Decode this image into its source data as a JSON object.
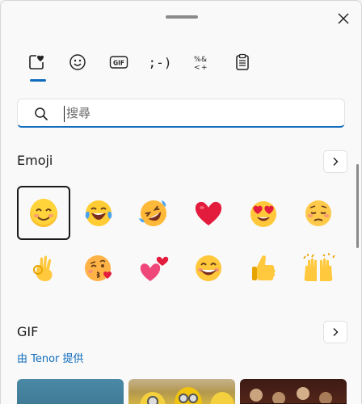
{
  "tabs": [
    {
      "id": "emoji",
      "icon": "heart-sticker-icon",
      "active": true
    },
    {
      "id": "kaomoji-faces",
      "icon": "smiley-icon"
    },
    {
      "id": "gif",
      "icon": "gif-icon",
      "label": "GIF"
    },
    {
      "id": "kaomoji",
      "icon": "kaomoji-icon",
      "label": ";-)"
    },
    {
      "id": "symbols",
      "icon": "symbols-icon",
      "label": "%&\n&lt;+"
    },
    {
      "id": "clipboard",
      "icon": "clipboard-icon"
    }
  ],
  "search": {
    "placeholder": "搜尋",
    "value": ""
  },
  "emoji_section": {
    "title": "Emoji"
  },
  "emojis": [
    {
      "name": "smiling-face-with-smiling-eyes",
      "selected": true
    },
    {
      "name": "face-with-tears-of-joy"
    },
    {
      "name": "rolling-on-the-floor-laughing"
    },
    {
      "name": "red-heart"
    },
    {
      "name": "smiling-face-with-heart-eyes"
    },
    {
      "name": "pensive-face"
    },
    {
      "name": "ok-hand"
    },
    {
      "name": "face-blowing-a-kiss"
    },
    {
      "name": "two-hearts"
    },
    {
      "name": "grinning-face"
    },
    {
      "name": "thumbs-up"
    },
    {
      "name": "raising-hands"
    }
  ],
  "gif_section": {
    "title": "GIF",
    "provider": "由 Tenor 提供"
  },
  "colors": {
    "accent": "#0f6cbd",
    "emoji_yellow": "#fcc42d",
    "heart_red": "#e0203a"
  }
}
